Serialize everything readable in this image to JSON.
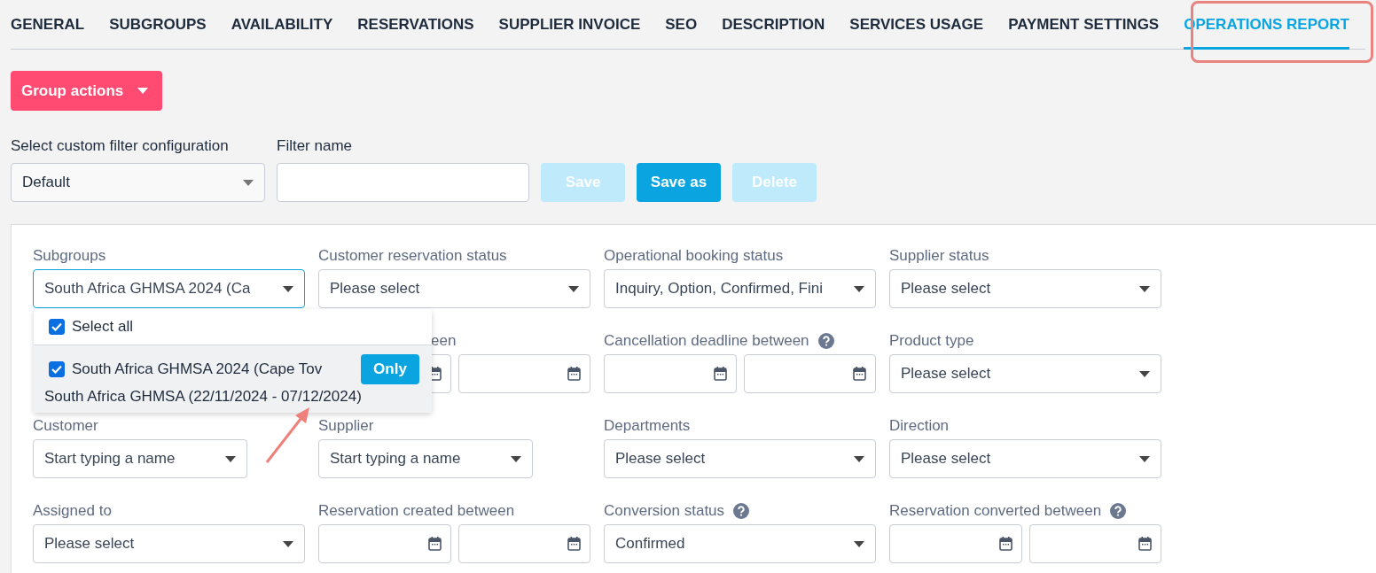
{
  "tabs": [
    {
      "label": "GENERAL",
      "selected": false
    },
    {
      "label": "SUBGROUPS",
      "selected": false
    },
    {
      "label": "AVAILABILITY",
      "selected": false
    },
    {
      "label": "RESERVATIONS",
      "selected": false
    },
    {
      "label": "SUPPLIER INVOICE",
      "selected": false
    },
    {
      "label": "SEO",
      "selected": false
    },
    {
      "label": "DESCRIPTION",
      "selected": false
    },
    {
      "label": "SERVICES USAGE",
      "selected": false
    },
    {
      "label": "PAYMENT SETTINGS",
      "selected": false
    },
    {
      "label": "OPERATIONS REPORT",
      "selected": true
    }
  ],
  "group_actions": {
    "label": "Group actions"
  },
  "filter_config": {
    "label": "Select custom filter configuration",
    "value": "Default"
  },
  "filter_name": {
    "label": "Filter name"
  },
  "filter_buttons": [
    {
      "label": "Save",
      "disabled": true
    },
    {
      "label": "Save as",
      "disabled": false
    },
    {
      "label": "Delete",
      "disabled": true
    }
  ],
  "filters": [
    {
      "kind": "select",
      "label": "Subgroups",
      "value": "South Africa GHMSA 2024 (Ca",
      "focused": true
    },
    {
      "kind": "select",
      "label": "Customer reservation status",
      "value": "Please select",
      "focused": false
    },
    {
      "kind": "select",
      "label": "Operational booking status",
      "value": "Inquiry, Option, Confirmed, Fini",
      "focused": false
    },
    {
      "kind": "select",
      "label": "Supplier status",
      "value": "Please select",
      "focused": false
    },
    {
      "kind": "blank"
    },
    {
      "kind": "daterange",
      "label": "een",
      "covered": true
    },
    {
      "kind": "daterange",
      "label": "Cancellation deadline between",
      "help": true
    },
    {
      "kind": "select",
      "label": "Product type",
      "value": "Please select",
      "focused": false
    },
    {
      "kind": "narrow",
      "label": "Customer",
      "value": "Start typing a name",
      "focused": false
    },
    {
      "kind": "narrow",
      "label": "Supplier",
      "value": "Start typing a name",
      "focused": false
    },
    {
      "kind": "select",
      "label": "Departments",
      "value": "Please select",
      "focused": false
    },
    {
      "kind": "select",
      "label": "Direction",
      "value": "Please select",
      "focused": false
    },
    {
      "kind": "select",
      "label": "Assigned to",
      "value": "Please select",
      "focused": false
    },
    {
      "kind": "daterange",
      "label": "Reservation created between"
    },
    {
      "kind": "select",
      "label": "Conversion status",
      "value": "Confirmed",
      "focused": false,
      "help": true
    },
    {
      "kind": "daterange",
      "label": "Reservation converted between",
      "help": true
    }
  ],
  "subgroup_dropdown": {
    "select_all": {
      "label": "Select all",
      "checked": true
    },
    "items": [
      {
        "label": "South Africa GHMSA 2024 (Cape Tov",
        "checked": true,
        "only": "Only",
        "detail": "South Africa GHMSA (22/11/2024 - 07/12/2024)"
      }
    ]
  }
}
